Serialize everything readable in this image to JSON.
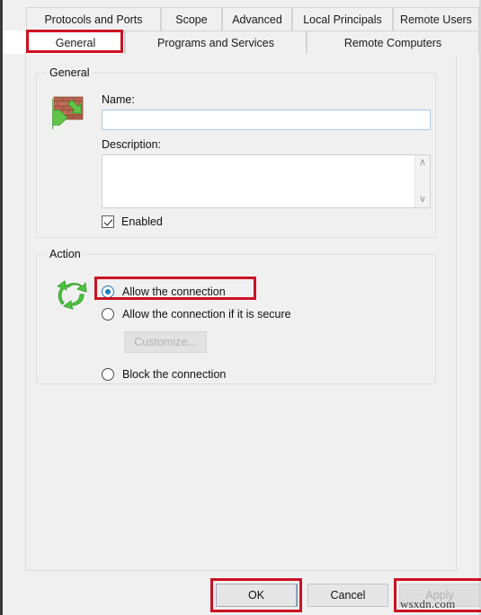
{
  "tabs": {
    "row1": [
      {
        "label": "Protocols and Ports",
        "active": false
      },
      {
        "label": "Scope",
        "active": false
      },
      {
        "label": "Advanced",
        "active": false
      },
      {
        "label": "Local Principals",
        "active": false
      },
      {
        "label": "Remote Users",
        "active": false
      }
    ],
    "row2": [
      {
        "label": "General",
        "active": true
      },
      {
        "label": "Programs and Services",
        "active": false
      },
      {
        "label": "Remote Computers",
        "active": false
      }
    ]
  },
  "general_group": {
    "legend": "General",
    "icon": "brick-wall-firewall-icon",
    "name_label": "Name:",
    "name_value": "",
    "name_placeholder": "",
    "description_label": "Description:",
    "description_value": "",
    "description_placeholder": "",
    "scroll_up": "∧",
    "scroll_down": "∨",
    "enabled_label": "Enabled",
    "enabled_checked": true
  },
  "action_group": {
    "legend": "Action",
    "icon": "green-recycle-arrows-icon",
    "options": [
      {
        "label": "Allow the connection",
        "selected": true
      },
      {
        "label": "Allow the connection if it is secure",
        "selected": false
      },
      {
        "label": "Block the connection",
        "selected": false
      }
    ],
    "customize_label": "Customize...",
    "customize_disabled": true
  },
  "footer": {
    "ok_label": "OK",
    "cancel_label": "Cancel",
    "apply_label": "Apply",
    "apply_disabled": true
  },
  "watermark": "wsxdn.com",
  "annotation": {
    "color": "#cc1122"
  }
}
